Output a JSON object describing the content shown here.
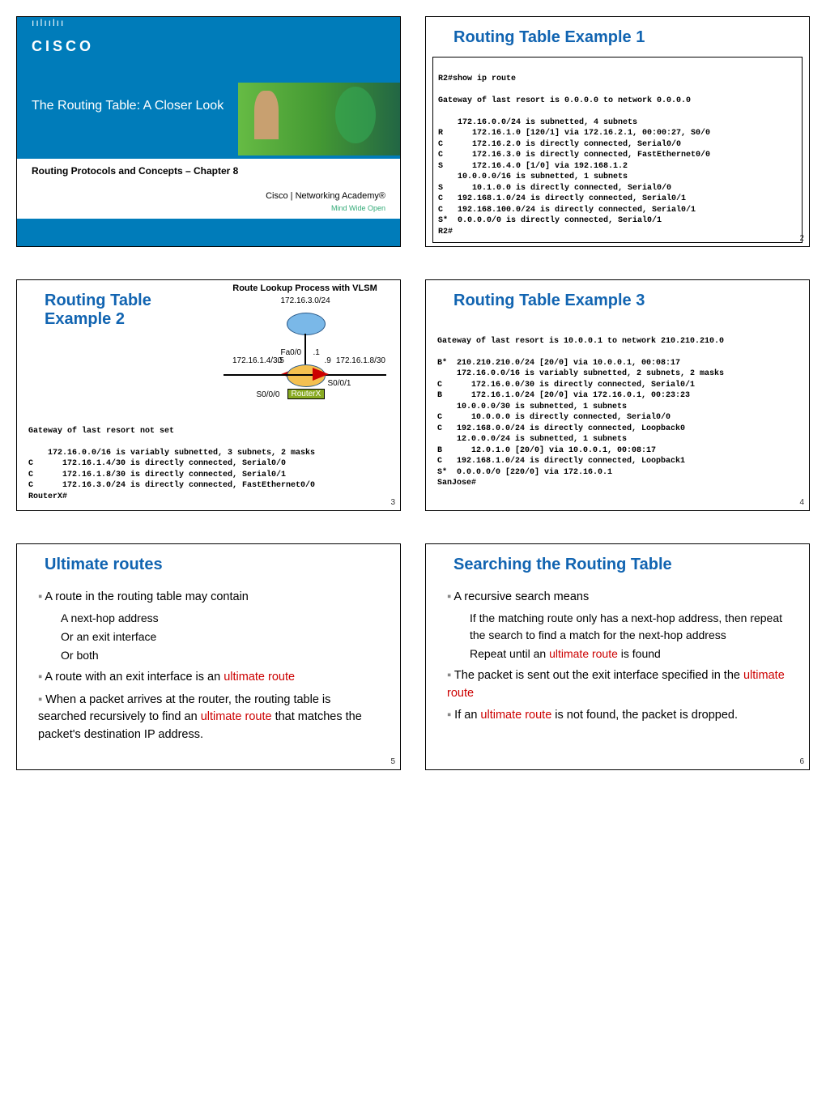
{
  "slide1": {
    "logo_bars": "ıılıılıı",
    "logo_text": "CISCO",
    "title": "The Routing Table: A Closer Look",
    "subtitle": "Routing Protocols and Concepts – Chapter 8",
    "academy": "Cisco | Networking Academy®",
    "academy_sub": "Mind Wide Open"
  },
  "slide2": {
    "heading": "Routing Table Example 1",
    "prompt": "R2#show ip route",
    "gateway": "Gateway of last resort is 0.0.0.0 to network 0.0.0.0",
    "lines": [
      "    172.16.0.0/24 is subnetted, 4 subnets",
      "R      172.16.1.0 [120/1] via 172.16.2.1, 00:00:27, S0/0",
      "C      172.16.2.0 is directly connected, Serial0/0",
      "C      172.16.3.0 is directly connected, FastEthernet0/0",
      "S      172.16.4.0 [1/0] via 192.168.1.2",
      "    10.0.0.0/16 is subnetted, 1 subnets",
      "S      10.1.0.0 is directly connected, Serial0/0",
      "C   192.168.1.0/24 is directly connected, Serial0/1",
      "C   192.168.100.0/24 is directly connected, Serial0/1",
      "S*  0.0.0.0/0 is directly connected, Serial0/1",
      "R2#"
    ],
    "page": "2"
  },
  "slide3": {
    "heading": "Routing Table Example 2",
    "diagram_title": "Route Lookup Process with VLSM",
    "net_top": "172.16.3.0/24",
    "net_left": "172.16.1.4/30",
    "net_right": "172.16.1.8/30",
    "if_top": "Fa0/0",
    "if_top_r": ".1",
    "if_l": ".5",
    "if_r": ".9",
    "if_ls": "S0/0/0",
    "if_rs": "S0/0/1",
    "router_name": "RouterX",
    "gateway": "Gateway of last resort not set",
    "lines": [
      "    172.16.0.0/16 is variably subnetted, 3 subnets, 2 masks",
      "C      172.16.1.4/30 is directly connected, Serial0/0",
      "C      172.16.1.8/30 is directly connected, Serial0/1",
      "C      172.16.3.0/24 is directly connected, FastEthernet0/0",
      "RouterX#"
    ],
    "page": "3"
  },
  "slide4": {
    "heading": "Routing Table Example 3",
    "gateway": "Gateway of last resort is 10.0.0.1 to network 210.210.210.0",
    "lines": [
      "B*  210.210.210.0/24 [20/0] via 10.0.0.1, 00:08:17",
      "    172.16.0.0/16 is variably subnetted, 2 subnets, 2 masks",
      "C      172.16.0.0/30 is directly connected, Serial0/1",
      "B      172.16.1.0/24 [20/0] via 172.16.0.1, 00:23:23",
      "    10.0.0.0/30 is subnetted, 1 subnets",
      "C      10.0.0.0 is directly connected, Serial0/0",
      "C   192.168.0.0/24 is directly connected, Loopback0",
      "    12.0.0.0/24 is subnetted, 1 subnets",
      "B      12.0.1.0 [20/0] via 10.0.0.1, 00:08:17",
      "C   192.168.1.0/24 is directly connected, Loopback1",
      "S*  0.0.0.0/0 [220/0] via 172.16.0.1",
      "SanJose#"
    ],
    "page": "4"
  },
  "slide5": {
    "heading": "Ultimate routes",
    "b1": "A route in the routing table may contain",
    "b1a": "A next-hop address",
    "b1b": "Or an exit interface",
    "b1c": "Or both",
    "b2_pre": "A route with an exit interface is an ",
    "b2_red": "ultimate route",
    "b3_pre": "When a packet arrives at the router, the routing table is searched recursively to find an ",
    "b3_red": "ultimate route",
    "b3_post": " that matches the packet's destination IP address.",
    "page": "5"
  },
  "slide6": {
    "heading": "Searching the Routing Table",
    "b1": "A recursive search means",
    "b1a": "If the matching route only has a next-hop address, then repeat the search to find a match for the next-hop address",
    "b1b_pre": "Repeat until an ",
    "b1b_red": "ultimate route",
    "b1b_post": " is found",
    "b2_pre": "The packet is sent out the exit interface specified in the ",
    "b2_red": "ultimate route",
    "b3_pre": "If an ",
    "b3_red": "ultimate route",
    "b3_post": " is not found, the packet is dropped.",
    "page": "6"
  }
}
